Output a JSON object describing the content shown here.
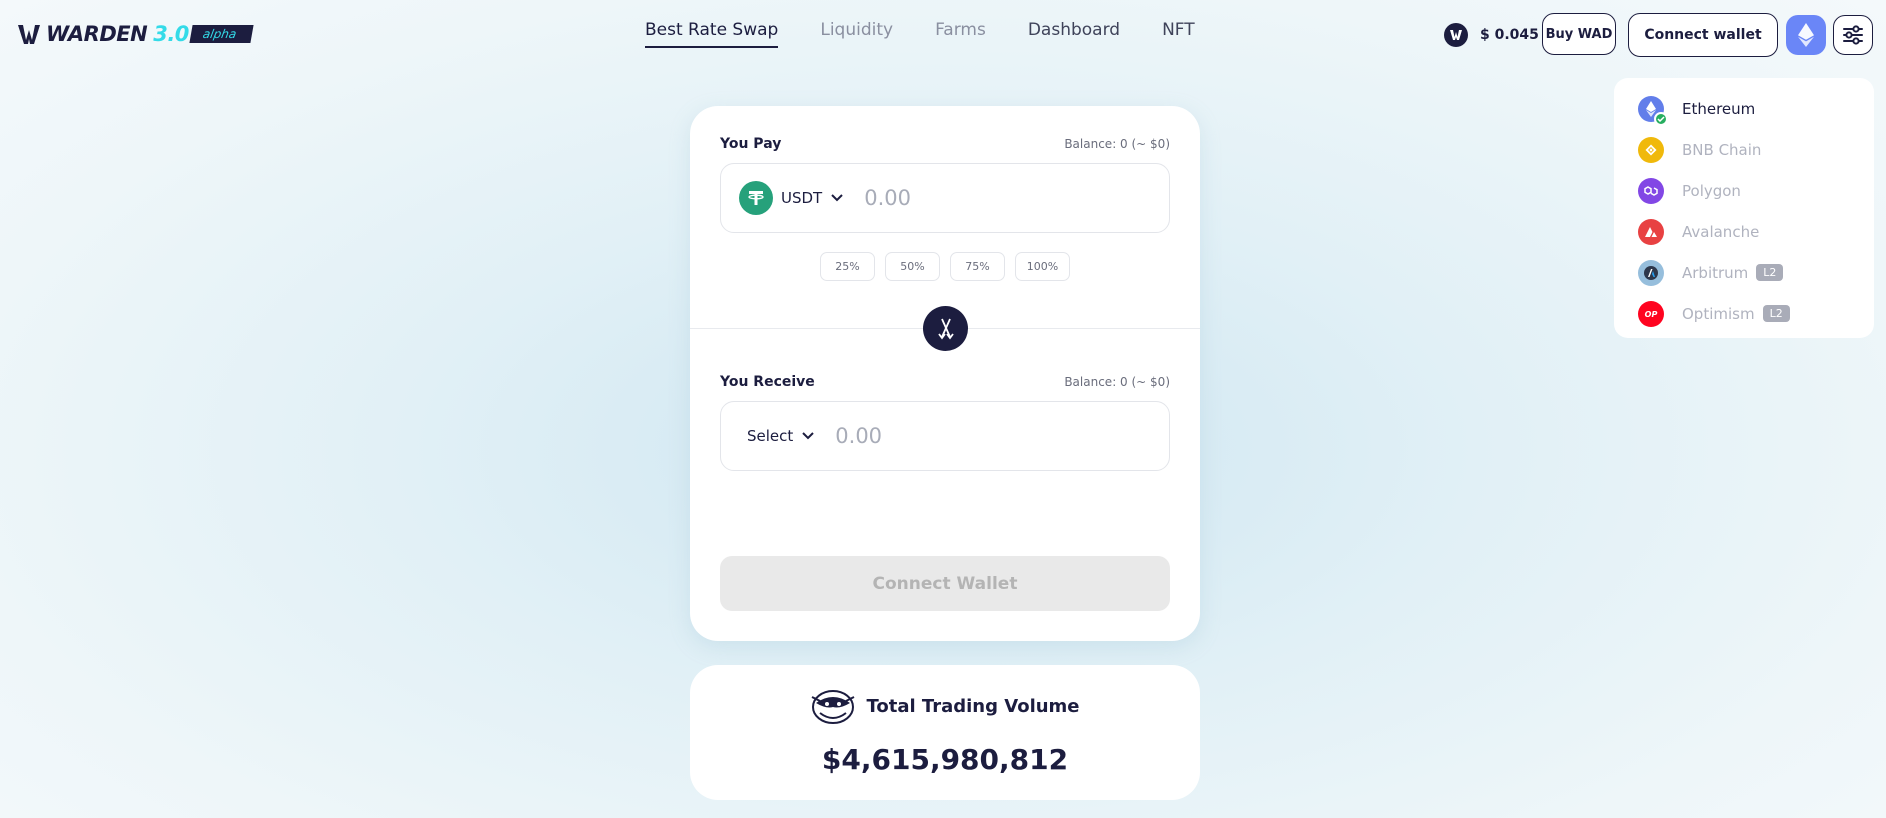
{
  "header": {
    "logo_text": "WARDEN",
    "logo_version": "3.0",
    "logo_badge": "alpha",
    "nav": [
      {
        "label": "Best Rate Swap"
      },
      {
        "label": "Liquidity"
      },
      {
        "label": "Farms"
      },
      {
        "label": "Dashboard"
      },
      {
        "label": "NFT"
      }
    ],
    "wad_price": "$ 0.045",
    "buy_label": "Buy WAD",
    "connect_label": "Connect wallet",
    "chain_icon": "ethereum-icon",
    "settings_icon": "settings-sliders-icon"
  },
  "network_menu": {
    "items": [
      {
        "label": "Ethereum",
        "icon": "ethereum-icon",
        "color": "#627EEA",
        "selected": true
      },
      {
        "label": "BNB Chain",
        "icon": "bnb-icon",
        "color": "#F0B90B"
      },
      {
        "label": "Polygon",
        "icon": "polygon-icon",
        "color": "#8247E5"
      },
      {
        "label": "Avalanche",
        "icon": "avalanche-icon",
        "color": "#E84142"
      },
      {
        "label": "Arbitrum",
        "icon": "arbitrum-icon",
        "color": "#96BEDC",
        "badge": "L2"
      },
      {
        "label": "Optimism",
        "icon": "optimism-icon",
        "color": "#FF0420",
        "badge": "L2"
      }
    ]
  },
  "swap": {
    "pay_label": "You Pay",
    "pay_balance": "Balance: 0 (~ $0)",
    "pay_token": "USDT",
    "pay_placeholder": "0.00",
    "percent_buttons": [
      "25%",
      "50%",
      "75%",
      "100%"
    ],
    "receive_label": "You Receive",
    "receive_balance": "Balance: 0 (~ $0)",
    "receive_token": "Select",
    "receive_placeholder": "0.00",
    "action_label": "Connect Wallet"
  },
  "volume": {
    "title": "Total Trading Volume",
    "value": "$4,615,980,812"
  },
  "colors": {
    "brand_dark": "#1c1d3f",
    "accent_cyan": "#33dbe8",
    "chain_button": "#6a86f7"
  }
}
